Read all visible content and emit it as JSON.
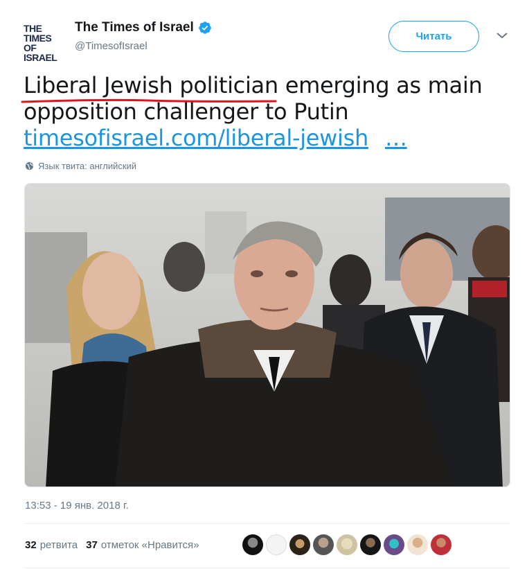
{
  "account": {
    "logo_line1": "THE TIMES",
    "logo_line2": "OF ISRAEL",
    "display_name": "The Times of Israel",
    "handle": "@TimesofIsrael",
    "verified_icon": "verified-badge",
    "follow_label": "Читать",
    "menu_icon": "chevron-down"
  },
  "tweet": {
    "text_part1": "Liberal Jewish politician emerging as main opposition challenger to Putin",
    "link_text": "timesofisrael.com/liberal-jewish",
    "link_ellipsis": "…",
    "language_note": "Язык твита: английский",
    "timestamp": "13:53 - 19 янв. 2018 г."
  },
  "stats": {
    "retweets_count": "32",
    "retweets_label": "ретвита",
    "likes_count": "37",
    "likes_label": "отметок «Нравится»"
  },
  "colors": {
    "accent": "#1da1f2",
    "link": "#1b95e0",
    "muted": "#657786",
    "underline_mark": "#e0141e"
  }
}
